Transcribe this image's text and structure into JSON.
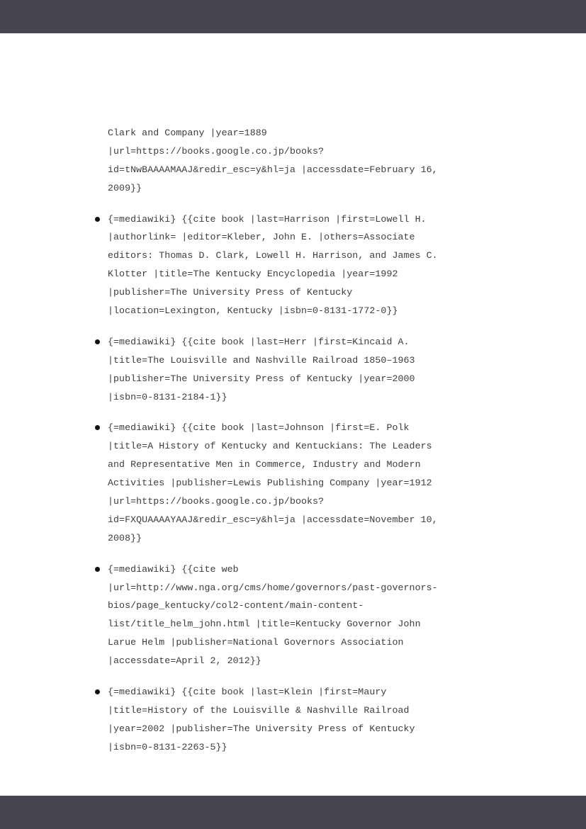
{
  "references": [
    {
      "bullet": false,
      "lines": [
        "Clark and Company |year=1889",
        "|url=https://books.google.co.jp/books?",
        "id=tNwBAAAAMAAJ&redir_esc=y&hl=ja |accessdate=February 16,",
        "2009}}"
      ]
    },
    {
      "bullet": true,
      "lines": [
        "{=mediawiki}     {{cite book |last=Harrison |first=Lowell H.",
        "|authorlink= |editor=Kleber, John E. |others=Associate",
        "editors: Thomas D. Clark, Lowell H. Harrison, and James C.",
        "Klotter |title=The Kentucky Encyclopedia |year=1992",
        "|publisher=The University Press of Kentucky",
        "|location=Lexington, Kentucky |isbn=0-8131-1772-0}}"
      ]
    },
    {
      "bullet": true,
      "lines": [
        "{=mediawiki}     {{cite book |last=Herr |first=Kincaid A.",
        "|title=The Louisville and Nashville Railroad 1850–1963",
        "|publisher=The University Press of Kentucky |year=2000",
        "|isbn=0-8131-2184-1}}"
      ]
    },
    {
      "bullet": true,
      "lines": [
        "{=mediawiki}     {{cite book |last=Johnson |first=E. Polk",
        "|title=A History of Kentucky and Kentuckians: The Leaders",
        "and Representative Men in Commerce, Industry and Modern",
        "Activities |publisher=Lewis Publishing Company |year=1912",
        "|url=https://books.google.co.jp/books?",
        "id=FXQUAAAAYAAJ&redir_esc=y&hl=ja |accessdate=November 10,",
        "2008}}"
      ]
    },
    {
      "bullet": true,
      "lines": [
        "{=mediawiki}     {{cite web",
        "|url=http://www.nga.org/cms/home/governors/past-governors-",
        "bios/page_kentucky/col2-content/main-content-",
        "list/title_helm_john.html |title=Kentucky Governor John",
        "Larue Helm |publisher=National Governors Association",
        "|accessdate=April 2, 2012}}"
      ]
    },
    {
      "bullet": true,
      "lines": [
        "{=mediawiki}     {{cite book |last=Klein |first=Maury",
        "|title=History of the Louisville & Nashville Railroad",
        "|year=2002 |publisher=The University Press of Kentucky",
        "|isbn=0-8131-2263-5}}"
      ]
    }
  ]
}
